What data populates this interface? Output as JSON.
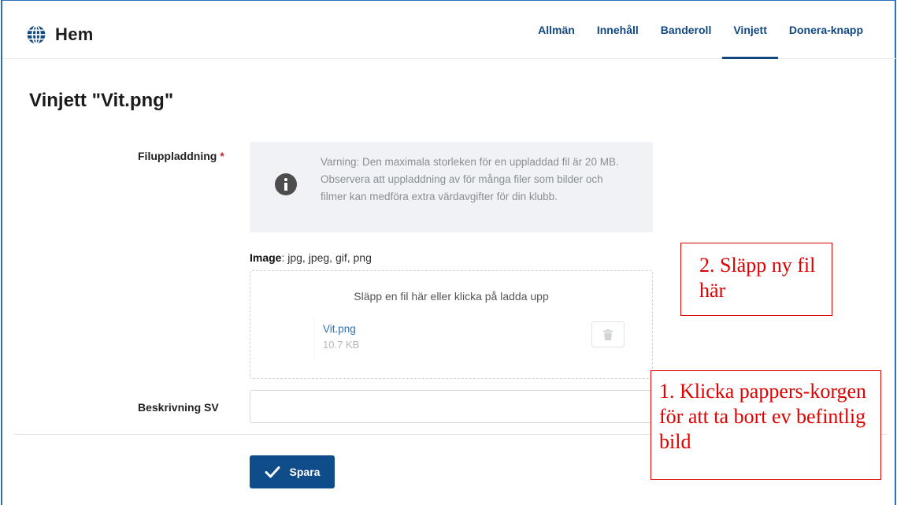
{
  "nav": {
    "brand": "Hem",
    "tabs": [
      {
        "label": "Allmän",
        "active": false
      },
      {
        "label": "Innehåll",
        "active": false
      },
      {
        "label": "Banderoll",
        "active": false
      },
      {
        "label": "Vinjett",
        "active": true
      },
      {
        "label": "Donera-knapp",
        "active": false
      }
    ]
  },
  "page": {
    "title": "Vinjett \"Vit.png\""
  },
  "form": {
    "upload_label": "Filuppladdning",
    "required_marker": "*",
    "warning_text": "Varning: Den maximala storleken för en uppladdad fil är 20 MB. Observera att uppladdning av för många filer som bilder och filmer kan medföra extra värdavgifter för din klubb.",
    "filetypes_prefix": "Image",
    "filetypes_list": ": jpg, jpeg, gif, png",
    "dropzone_text": "Släpp en fil här eller klicka på ladda upp",
    "file": {
      "name": "Vit.png",
      "size": "10.7 KB"
    },
    "description_label": "Beskrivning SV",
    "description_value": "",
    "save_label": "Spara"
  },
  "annotations": {
    "callout_2": "2. Släpp ny fil här",
    "callout_1": "1. Klicka pappers-korgen för att ta bort ev befintlig bild"
  },
  "colors": {
    "primary": "#0f4c8a",
    "link": "#2f6fb4",
    "annotation": "#e00000",
    "warning_bg": "#f0f2f5"
  },
  "icons": {
    "brand": "globe-icon",
    "warning": "info-icon",
    "delete": "trash-icon",
    "save": "checkmark-icon"
  }
}
